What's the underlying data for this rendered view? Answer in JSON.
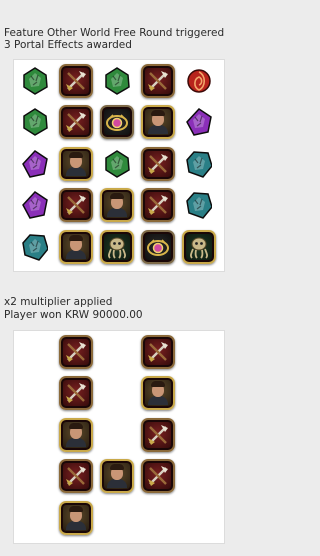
{
  "messages": {
    "feature_line1": "Feature Other World Free Round triggered",
    "feature_line2": "3 Portal Effects awarded",
    "result_line1": "x2 multiplier applied",
    "result_line2": "Player won KRW 90000.00"
  },
  "symbol_names": {
    "green-gem": "green gem",
    "purple-gem": "purple gem",
    "teal-gem": "teal gem",
    "red-orb": "red orb",
    "axes": "crossed axes",
    "hero": "hero portrait",
    "amulet": "golden amulet",
    "squid": "tentacle creature"
  },
  "colors": {
    "green_gem": "#2f8a3c",
    "purple_gem": "#8a2fb8",
    "teal_gem": "#2a7f86",
    "red_orb": "#b8241c",
    "frame_gold": "#c9a94a",
    "tile_red": "#6e1c1c"
  },
  "grid1": [
    [
      "green-gem",
      "axes",
      "green-gem",
      "axes",
      "red-orb"
    ],
    [
      "green-gem",
      "axes",
      "amulet",
      "hero",
      "purple-gem"
    ],
    [
      "purple-gem",
      "hero",
      "green-gem",
      "axes",
      "teal-gem"
    ],
    [
      "purple-gem",
      "axes",
      "hero",
      "axes",
      "teal-gem"
    ],
    [
      "teal-gem",
      "hero",
      "squid",
      "amulet",
      "squid"
    ]
  ],
  "grid2": [
    [
      "",
      "axes",
      "",
      "axes",
      ""
    ],
    [
      "",
      "axes",
      "",
      "hero",
      ""
    ],
    [
      "",
      "hero",
      "",
      "axes",
      ""
    ],
    [
      "",
      "axes",
      "hero",
      "axes",
      ""
    ],
    [
      "",
      "hero",
      "",
      "",
      ""
    ]
  ]
}
